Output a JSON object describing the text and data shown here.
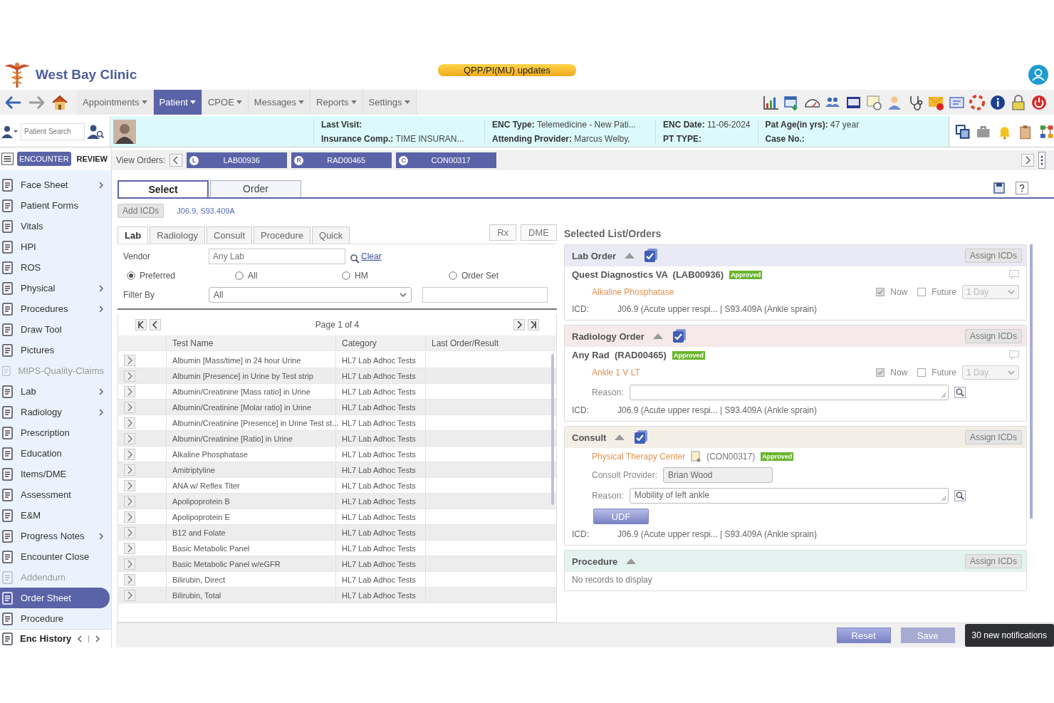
{
  "header": {
    "clinic_name": "West Bay Clinic",
    "banner": "QPP/PI(MU) updates"
  },
  "nav": {
    "menus": [
      {
        "label": "Appointments",
        "selected": false
      },
      {
        "label": "Patient",
        "selected": true
      },
      {
        "label": "CPOE",
        "selected": false
      },
      {
        "label": "Messages",
        "selected": false
      },
      {
        "label": "Reports",
        "selected": false
      },
      {
        "label": "Settings",
        "selected": false
      }
    ]
  },
  "patient_bar": {
    "search_placeholder": "Patient Search",
    "info_columns": [
      [
        {
          "label": "Last Visit:"
        },
        {
          "label": "Insurance Comp.:",
          "value": "TIME INSURAN..."
        }
      ],
      [
        {
          "label": "ENC Type:",
          "value": "Telemedicine - New Pati..."
        },
        {
          "label": "Attending Provider:",
          "value": "Marcus Welby,"
        }
      ],
      [
        {
          "label": "ENC Date:",
          "value": "11-06-2024"
        },
        {
          "label": "PT TYPE:"
        }
      ],
      [
        {
          "label": "Pat Age(in yrs):",
          "value": "47 year"
        },
        {
          "label": "Case No.:"
        }
      ]
    ]
  },
  "encounter_toggle": [
    {
      "label": "ENCOUNTER",
      "selected": true
    },
    {
      "label": "REVIEW",
      "selected": false
    }
  ],
  "view_orders": {
    "label": "View Orders:",
    "orders": [
      {
        "badge": "L",
        "code": "LAB00936"
      },
      {
        "badge": "R",
        "code": "RAD00465"
      },
      {
        "badge": "C",
        "code": "CON00317"
      }
    ]
  },
  "sidebar": {
    "items": [
      {
        "label": "Face Sheet",
        "expandable": true,
        "disabled": false,
        "selected": false
      },
      {
        "label": "Patient Forms",
        "expandable": false,
        "disabled": false,
        "selected": false
      },
      {
        "label": "Vitals",
        "expandable": false,
        "disabled": false,
        "selected": false
      },
      {
        "label": "HPI",
        "expandable": false,
        "disabled": false,
        "selected": false
      },
      {
        "label": "ROS",
        "expandable": false,
        "disabled": false,
        "selected": false
      },
      {
        "label": "Physical",
        "expandable": true,
        "disabled": false,
        "selected": false
      },
      {
        "label": "Procedures",
        "expandable": true,
        "disabled": false,
        "selected": false
      },
      {
        "label": "Draw Tool",
        "expandable": false,
        "disabled": false,
        "selected": false
      },
      {
        "label": "Pictures",
        "expandable": false,
        "disabled": false,
        "selected": false
      },
      {
        "label": "MIPS-Quality-Claims",
        "expandable": false,
        "disabled": true,
        "selected": false
      },
      {
        "label": "Lab",
        "expandable": true,
        "disabled": false,
        "selected": false
      },
      {
        "label": "Radiology",
        "expandable": true,
        "disabled": false,
        "selected": false
      },
      {
        "label": "Prescription",
        "expandable": false,
        "disabled": false,
        "selected": false
      },
      {
        "label": "Education",
        "expandable": false,
        "disabled": false,
        "selected": false
      },
      {
        "label": "Items/DME",
        "expandable": false,
        "disabled": false,
        "selected": false
      },
      {
        "label": "Assessment",
        "expandable": false,
        "disabled": false,
        "selected": false
      },
      {
        "label": "E&M",
        "expandable": false,
        "disabled": false,
        "selected": false
      },
      {
        "label": "Progress Notes",
        "expandable": true,
        "disabled": false,
        "selected": false
      },
      {
        "label": "Encounter Close",
        "expandable": false,
        "disabled": false,
        "selected": false
      },
      {
        "label": "Addendum",
        "expandable": false,
        "disabled": true,
        "selected": false
      },
      {
        "label": "Order Sheet",
        "expandable": false,
        "disabled": false,
        "selected": true
      },
      {
        "label": "Procedure",
        "expandable": false,
        "disabled": false,
        "selected": false
      }
    ],
    "footer": "Enc History"
  },
  "main_tabs": [
    {
      "label": "Select",
      "selected": true
    },
    {
      "label": "Order",
      "selected": false
    }
  ],
  "icd_bar": {
    "button": "Add ICDs",
    "codes": "J06.9, S93.409A"
  },
  "order_tabs": [
    {
      "label": "Lab",
      "selected": true
    },
    {
      "label": "Radiology",
      "selected": false
    },
    {
      "label": "Consult",
      "selected": false
    },
    {
      "label": "Procedure",
      "selected": false
    },
    {
      "label": "Quick",
      "selected": false
    }
  ],
  "side_buttons": [
    "Rx",
    "DME"
  ],
  "vendor": {
    "label": "Vendor",
    "placeholder": "Any Lab",
    "clear": "Clear"
  },
  "source_radios": [
    {
      "label": "Preferred",
      "selected": true
    },
    {
      "label": "All",
      "selected": false
    },
    {
      "label": "HM",
      "selected": false
    },
    {
      "label": "Order Set",
      "selected": false
    }
  ],
  "filter": {
    "label": "Filter By",
    "value": "All"
  },
  "pager": "Page 1 of 4",
  "table": {
    "columns": [
      "Test Name",
      "Category",
      "Last Order/Result"
    ],
    "rows": [
      {
        "test_name": "Albumin [Mass/time] in 24 hour Urine",
        "category": "HL7 Lab Adhoc Tests"
      },
      {
        "test_name": "Albumin [Presence] in Urine by Test strip",
        "category": "HL7 Lab Adhoc Tests"
      },
      {
        "test_name": "Albumin/Creatinine [Mass ratio] in Urine",
        "category": "HL7 Lab Adhoc Tests"
      },
      {
        "test_name": "Albumin/Creatinine [Molar ratio] in Urine",
        "category": "HL7 Lab Adhoc Tests"
      },
      {
        "test_name": "Albumin/Creatinine [Presence] in Urine Test st...",
        "category": "HL7 Lab Adhoc Tests"
      },
      {
        "test_name": "Albumin/Creatinine [Ratio] in Urine",
        "category": "HL7 Lab Adhoc Tests"
      },
      {
        "test_name": "Alkaline Phosphatase",
        "category": "HL7 Lab Adhoc Tests"
      },
      {
        "test_name": "Amitriptyline",
        "category": "HL7 Lab Adhoc Tests"
      },
      {
        "test_name": "ANA w/ Reflex Titer",
        "category": "HL7 Lab Adhoc Tests"
      },
      {
        "test_name": "Apolipoprotein B",
        "category": "HL7 Lab Adhoc Tests"
      },
      {
        "test_name": "Apolipoprotein E",
        "category": "HL7 Lab Adhoc Tests"
      },
      {
        "test_name": "B12 and Folate",
        "category": "HL7 Lab Adhoc Tests"
      },
      {
        "test_name": "Basic Metabolic Panel",
        "category": "HL7 Lab Adhoc Tests"
      },
      {
        "test_name": "Basic Metabolic Panel w/eGFR",
        "category": "HL7 Lab Adhoc Tests"
      },
      {
        "test_name": "Bilirubin, Direct",
        "category": "HL7 Lab Adhoc Tests"
      },
      {
        "test_name": "Bilirubin, Total",
        "category": "HL7 Lab Adhoc Tests"
      }
    ]
  },
  "selected_orders": {
    "title": "Selected List/Orders",
    "sections": [
      {
        "kind": "lab",
        "title": "Lab Order",
        "color": "#e9eaf5",
        "assign": "Assign ICDs",
        "provider": "Quest Diagnostics VA",
        "code": "(LAB00936)",
        "status": "Approved",
        "item": "Alkaline Phosphatase",
        "now": {
          "label": "Now",
          "checked": true
        },
        "future": {
          "label": "Future",
          "checked": false
        },
        "delay": "1 Day",
        "icd_label": "ICD:",
        "icd": "J06.9 (Acute upper respi... | S93.409A (Ankle sprain)"
      },
      {
        "kind": "radiology",
        "title": "Radiology Order",
        "color": "#f5e9ea",
        "assign": "Assign ICDs",
        "provider": "Any Rad",
        "code": "(RAD00465)",
        "status": "Approved",
        "item": "Ankle 1 V LT",
        "now": {
          "label": "Now",
          "checked": true
        },
        "future": {
          "label": "Future",
          "checked": false
        },
        "delay": "1 Day",
        "reason_label": "Reason:",
        "icd_label": "ICD:",
        "icd": "J06.9 (Acute upper respi... | S93.409A (Ankle sprain)"
      },
      {
        "kind": "consult",
        "title": "Consult",
        "color": "#f3efe6",
        "assign": "Assign ICDs",
        "provider": "Physical Therapy Center",
        "code": "(CON00317)",
        "status": "Approved",
        "consult_provider_label": "Consult Provider:",
        "consult_provider": "Brian Wood",
        "reason_label": "Reason:",
        "reason": "Mobility of left ankle",
        "udf": "UDF",
        "icd_label": "ICD:",
        "icd": "J06.9 (Acute upper respi... | S93.409A (Ankle sprain)"
      },
      {
        "kind": "procedure",
        "title": "Procedure",
        "color": "#e4f3f0",
        "assign": "Assign ICDs",
        "empty_text": "No records to display"
      }
    ]
  },
  "footer": {
    "reset": "Reset",
    "save": {
      "label": "Save",
      "disabled": true
    },
    "toast": "30 new notifications"
  }
}
